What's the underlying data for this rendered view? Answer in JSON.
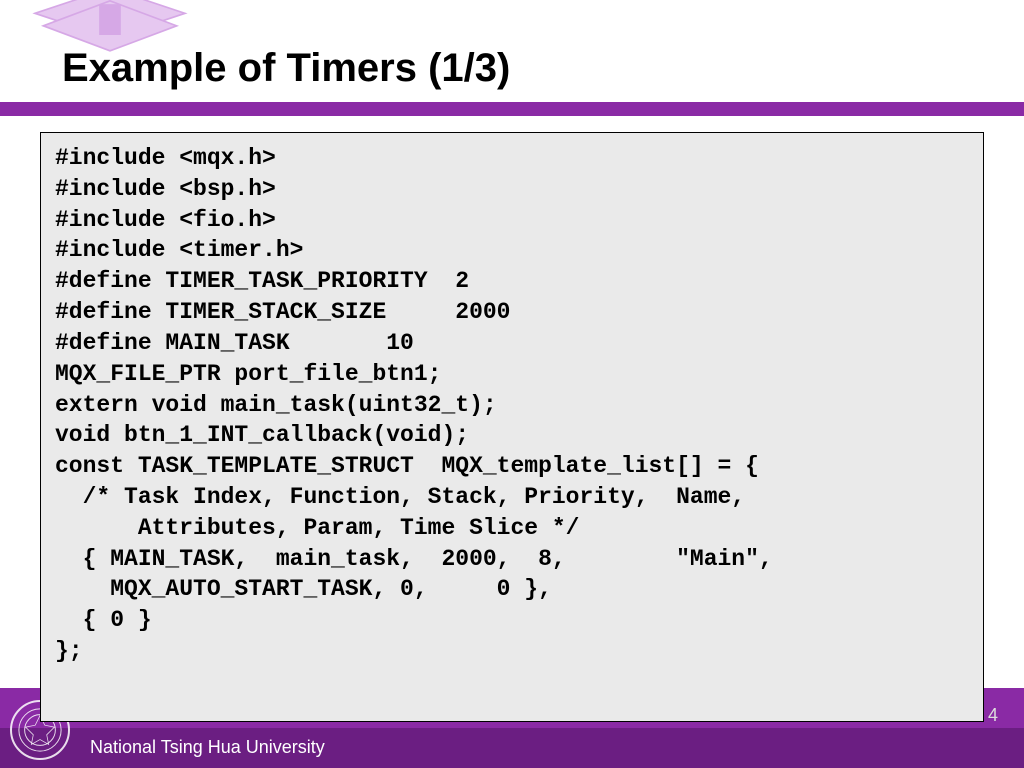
{
  "slide": {
    "title": "Example of Timers (1/3)",
    "number": "4",
    "footer": "National Tsing Hua University"
  },
  "code": "#include <mqx.h>\n#include <bsp.h>\n#include <fio.h>\n#include <timer.h>\n#define TIMER_TASK_PRIORITY  2\n#define TIMER_STACK_SIZE     2000\n#define MAIN_TASK       10\nMQX_FILE_PTR port_file_btn1;\nextern void main_task(uint32_t);\nvoid btn_1_INT_callback(void);\nconst TASK_TEMPLATE_STRUCT  MQX_template_list[] = {\n  /* Task Index, Function, Stack, Priority,  Name,\n      Attributes, Param, Time Slice */\n  { MAIN_TASK,  main_task,  2000,  8,        \"Main\",\n    MQX_AUTO_START_TASK, 0,     0 },\n  { 0 }\n};"
}
